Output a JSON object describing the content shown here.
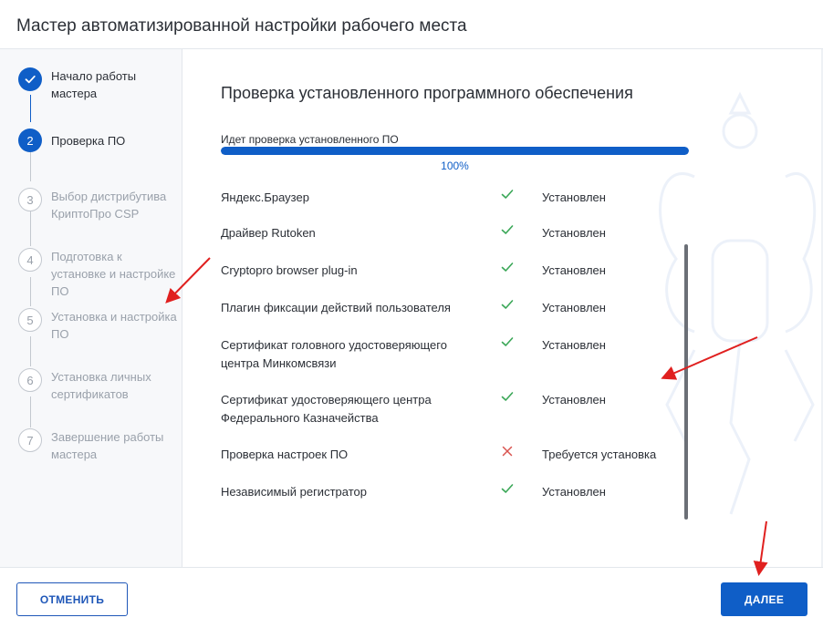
{
  "header": {
    "title": "Мастер автоматизированной настройки рабочего места"
  },
  "steps": [
    {
      "number": "1",
      "label": "Начало работы мастера",
      "state": "done",
      "icon": "check-icon"
    },
    {
      "number": "2",
      "label": "Проверка ПО",
      "state": "active"
    },
    {
      "number": "3",
      "label": "Выбор дистрибутива КриптоПро CSP",
      "state": "pending"
    },
    {
      "number": "4",
      "label": "Подготовка к установке и настройке ПО",
      "state": "pending"
    },
    {
      "number": "5",
      "label": "Установка и настройка ПО",
      "state": "pending"
    },
    {
      "number": "6",
      "label": "Установка личных сертификатов",
      "state": "pending"
    },
    {
      "number": "7",
      "label": "Завершение работы мастера",
      "state": "pending"
    }
  ],
  "main": {
    "title": "Проверка установленного программного обеспечения",
    "progress": {
      "label": "Идет проверка установленного ПО",
      "percent_text": "100%",
      "value": 1.0
    },
    "software": [
      {
        "name": "Яндекс.Браузер",
        "status": "Установлен",
        "icon": "check-icon"
      },
      {
        "name": "Драйвер Rutoken",
        "status": "Установлен",
        "icon": "check-icon"
      },
      {
        "name": "Cryptopro browser plug-in",
        "status": "Установлен",
        "icon": "check-icon"
      },
      {
        "name": "Плагин фиксации действий пользователя",
        "status": "Установлен",
        "icon": "check-icon"
      },
      {
        "name": "Сертификат головного удостоверяющего центра Минкомсвязи",
        "status": "Установлен",
        "icon": "check-icon"
      },
      {
        "name": "Сертификат удостоверяющего центра Федерального Казначейства",
        "status": "Установлен",
        "icon": "check-icon"
      },
      {
        "name": "Проверка настроек ПО",
        "status": "Требуется установка",
        "icon": "cross-icon"
      },
      {
        "name": "Независимый регистратор",
        "status": "Установлен",
        "icon": "check-icon"
      }
    ]
  },
  "footer": {
    "cancel_label": "ОТМЕНИТЬ",
    "next_label": "ДАЛЕЕ"
  },
  "colors": {
    "accent": "#0f5ec7",
    "success": "#3aa757",
    "error": "#d9534f",
    "annotation": "#e0201f"
  }
}
